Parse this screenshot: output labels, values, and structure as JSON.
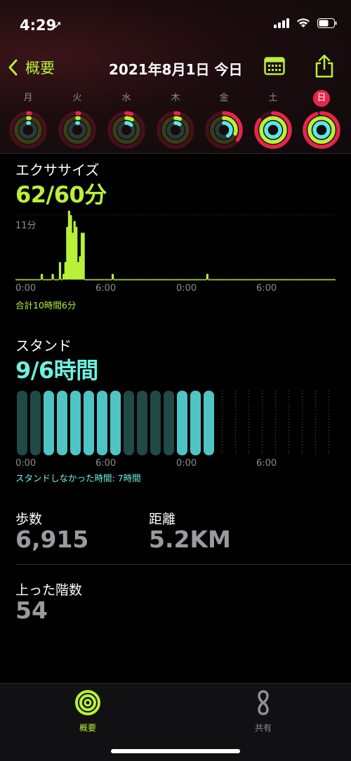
{
  "status": {
    "time": "4:29",
    "location_icon": "location-arrow-icon"
  },
  "nav": {
    "back_label": "概要",
    "title": "2021年8月1日 今日"
  },
  "week": {
    "days": [
      {
        "label": "月",
        "move": 0.02,
        "exercise": 0.02,
        "stand": 0.02,
        "today": false
      },
      {
        "label": "火",
        "move": 0.02,
        "exercise": 0.02,
        "stand": 0.02,
        "today": false
      },
      {
        "label": "水",
        "move": 0.05,
        "exercise": 0.08,
        "stand": 0.12,
        "today": false
      },
      {
        "label": "木",
        "move": 0.03,
        "exercise": 0.06,
        "stand": 0.1,
        "today": false
      },
      {
        "label": "金",
        "move": 0.35,
        "exercise": 0.3,
        "stand": 0.4,
        "today": false
      },
      {
        "label": "土",
        "move": 0.85,
        "exercise": 1.0,
        "stand": 1.0,
        "today": false
      },
      {
        "label": "日",
        "move": 0.95,
        "exercise": 1.0,
        "stand": 1.0,
        "today": true
      }
    ]
  },
  "exercise": {
    "label": "エクササイズ",
    "value": "62/60分",
    "y_max_label": "11分",
    "axis": [
      "0:00",
      "6:00",
      "0:00",
      "6:00"
    ],
    "total": "合計10時間6分",
    "minutes": [
      0,
      0,
      0,
      0,
      0,
      0,
      0,
      0,
      0,
      0,
      0,
      0,
      0,
      0,
      1,
      0,
      0,
      0,
      0,
      0,
      1,
      0,
      0,
      0,
      3,
      0,
      1,
      3,
      9,
      12,
      11,
      8,
      10,
      9,
      3,
      4,
      8,
      8,
      0,
      0,
      0,
      0,
      0,
      0,
      0,
      0,
      0,
      0,
      0,
      0,
      0,
      0,
      0,
      1,
      0,
      0,
      0,
      0,
      0,
      0,
      0,
      0,
      0,
      0,
      0,
      0,
      0,
      0,
      0,
      0,
      0,
      0,
      0,
      0,
      0,
      0,
      0,
      0,
      0,
      0,
      0,
      0,
      0,
      0,
      0,
      0,
      0,
      0,
      0,
      0,
      0,
      0,
      0,
      0,
      0,
      0,
      0,
      0,
      0,
      0,
      0,
      0,
      0,
      0,
      0,
      1,
      0,
      0,
      0,
      0,
      0,
      0,
      0,
      0,
      0,
      0,
      0,
      0,
      0,
      0,
      0,
      0,
      0,
      0,
      0,
      0,
      0,
      0,
      0,
      0,
      0,
      0,
      0,
      0,
      0,
      0,
      0,
      0,
      0,
      0,
      0,
      0,
      0,
      0,
      0,
      0,
      0,
      0,
      0,
      0,
      0,
      0,
      0,
      0,
      0,
      0,
      0,
      0,
      0,
      0,
      0,
      0,
      0,
      0,
      0,
      0,
      0,
      0,
      0,
      0,
      0,
      0,
      0,
      0,
      0,
      0
    ],
    "max_minutes": 11
  },
  "stand": {
    "label": "スタンド",
    "value": "9/6時間",
    "axis": [
      "0:00",
      "6:00",
      "0:00",
      "6:00"
    ],
    "note": "スタンドしなかった時間: 7時間",
    "hours": [
      0,
      0,
      1,
      1,
      1,
      1,
      1,
      1,
      0,
      0,
      0,
      0,
      1,
      1,
      1,
      2,
      2,
      2,
      2,
      2,
      2,
      2,
      2,
      2
    ]
  },
  "stats": {
    "steps_label": "歩数",
    "steps_value": "6,915",
    "distance_label": "距離",
    "distance_value": "5.2KM",
    "flights_label": "上った階数",
    "flights_value": "54"
  },
  "tabs": [
    {
      "label": "概要",
      "active": true
    },
    {
      "label": "共有",
      "active": false
    }
  ],
  "colors": {
    "move": "#e5264a",
    "exercise": "#b8f03a",
    "stand": "#5ce6e6",
    "accent": "#b8f03a"
  }
}
